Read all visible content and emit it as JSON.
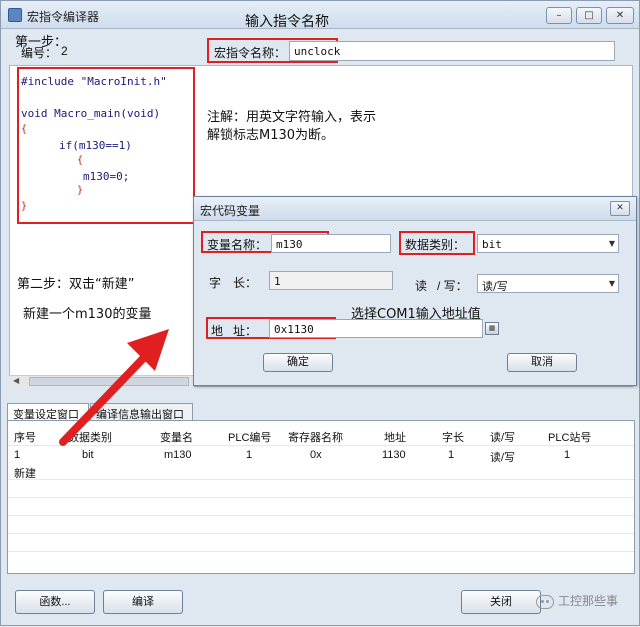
{
  "window": {
    "title": "宏指令编译器",
    "min_glyph": "–",
    "max_glyph": "□",
    "close_glyph": "✕"
  },
  "top": {
    "id_label": "编号：",
    "id_value": "2",
    "macro_name_label": "宏指令名称：",
    "macro_name_value": "unclock"
  },
  "annotations": {
    "enter_macro_name": "输入指令名称",
    "step1": "第一步：",
    "note_line1": "注解：用英文字符输入，表示",
    "note_line2": "解锁标志M130为断。",
    "step2_line1": "第二步：双击“新建”",
    "step2_line2": "新建一个m130的变量",
    "select_com1": "选择COM1输入地址值"
  },
  "code": {
    "lines": [
      "#include \"MacroInit.h\"",
      "void Macro_main(void)",
      "{",
      "if(m130==1)",
      "{",
      "m130=0;",
      "}",
      "}"
    ]
  },
  "dialog": {
    "title": "宏代码变量",
    "close_glyph": "✕",
    "var_name_label": "变量名称：",
    "var_name_value": "m130",
    "data_type_label": "数据类别：",
    "data_type_value": "bit",
    "word_len_label_a": "字",
    "word_len_label_b": "长：",
    "word_len_value": "1",
    "rw_label_a": "读",
    "rw_label_b": "/ 写：",
    "rw_value": "读/写",
    "address_label_a": "地",
    "address_label_b": "址：",
    "address_value": "0x1130",
    "calc_glyph": "▦",
    "ok_label": "确定",
    "cancel_label": "取消"
  },
  "tabs": [
    {
      "label": "变量设定窗口"
    },
    {
      "label": "编译信息输出窗口"
    }
  ],
  "table": {
    "columns": [
      "序号",
      "数据类别",
      "变量名",
      "PLC编号",
      "寄存器名称",
      "地址",
      "字长",
      "读/写",
      "PLC站号"
    ],
    "rows": [
      [
        "1",
        "bit",
        "m130",
        "1",
        "0x",
        "1130",
        "1",
        "读/写",
        "1"
      ]
    ],
    "new_label": "新建"
  },
  "buttons": {
    "functions": "函数...",
    "compile": "编译",
    "close": "关闭"
  },
  "watermark": "工控那些事",
  "colors": {
    "annotation_red": "#e02020",
    "window_bg": "#dfe7f1"
  }
}
